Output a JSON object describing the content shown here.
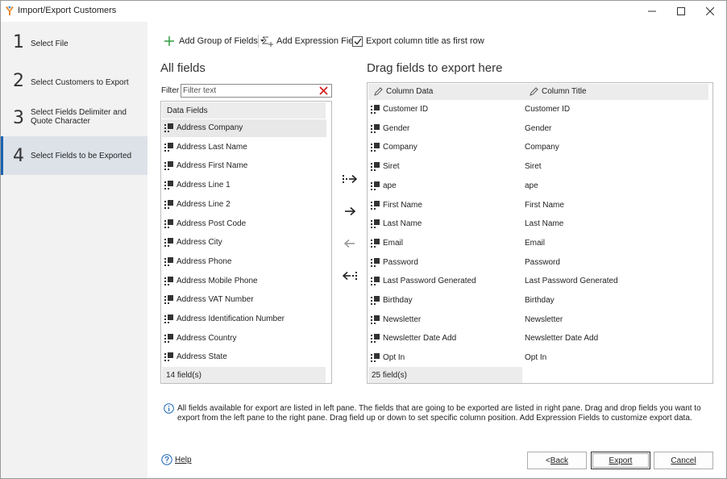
{
  "window": {
    "title": "Import/Export Customers"
  },
  "steps": [
    {
      "num": "1",
      "label": "Select File"
    },
    {
      "num": "2",
      "label": "Select Customers to Export"
    },
    {
      "num": "3",
      "label": "Select Fields Delimiter and Quote Character"
    },
    {
      "num": "4",
      "label": "Select Fields to be Exported"
    }
  ],
  "toolbar": {
    "add_group": "Add Group of Fields",
    "add_expression": "Add Expression Field",
    "export_title_checkbox": "Export column title as first row",
    "export_title_checked": true
  },
  "left": {
    "title": "All fields",
    "filter_label": "Filter",
    "filter_placeholder": "Filter text",
    "group_header": "Data Fields",
    "items": [
      "Address Company",
      "Address Last Name",
      "Address First Name",
      "Address Line 1",
      "Address Line 2",
      "Address Post Code",
      "Address City",
      "Address Phone",
      "Address Mobile Phone",
      "Address VAT Number",
      "Address Identification Number",
      "Address Country",
      "Address State"
    ],
    "footer": "14 field(s)"
  },
  "right": {
    "title": "Drag fields to export here",
    "col_data": "Column Data",
    "col_title": "Column Title",
    "rows": [
      {
        "data": "Customer ID",
        "title": "Customer ID"
      },
      {
        "data": "Gender",
        "title": "Gender"
      },
      {
        "data": "Company",
        "title": "Company"
      },
      {
        "data": "Siret",
        "title": "Siret"
      },
      {
        "data": "ape",
        "title": "ape"
      },
      {
        "data": "First Name",
        "title": "First Name"
      },
      {
        "data": "Last Name",
        "title": "Last Name"
      },
      {
        "data": "Email",
        "title": "Email"
      },
      {
        "data": "Password",
        "title": "Password"
      },
      {
        "data": "Last Password Generated",
        "title": "Last Password Generated"
      },
      {
        "data": "Birthday",
        "title": "Birthday"
      },
      {
        "data": "Newsletter",
        "title": "Newsletter"
      },
      {
        "data": "Newsletter Date Add",
        "title": "Newsletter Date Add"
      },
      {
        "data": "Opt In",
        "title": "Opt In"
      }
    ],
    "footer": "25 field(s)"
  },
  "info": "All fields available for export are listed in left pane. The fields that are going to be exported are listed in right pane. Drag and drop fields you want to export from the left pane to the right pane. Drag field up or down to set specific column position. Add Expression Fields to customize export data.",
  "buttons": {
    "help": "Help",
    "back_prefix": "< ",
    "back": "Back",
    "export": "Export",
    "cancel": "Cancel"
  },
  "colors": {
    "add_icon": "#2e9e3e",
    "clear_icon": "#d42020",
    "info_icon": "#1a64b4",
    "active_step_accent": "#1a64b4"
  },
  "icons": {
    "add_group": "plus-icon",
    "add_expression": "sigma-plus-icon",
    "filter_clear": "close-x-icon",
    "field_drag": "drag-handle-icon",
    "column_edit": "pencil-icon",
    "move_all_right": "double-arrow-right-icon",
    "move_right": "arrow-right-icon",
    "move_left": "arrow-left-icon",
    "move_all_left": "double-arrow-left-icon",
    "info": "info-circle-icon",
    "help": "question-circle-icon"
  }
}
